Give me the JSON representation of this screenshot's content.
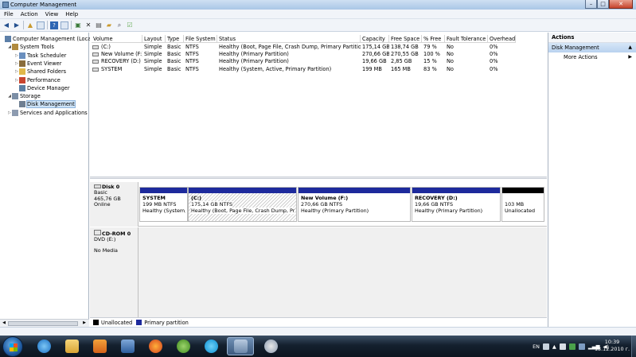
{
  "window": {
    "title": "Computer Management",
    "min": "–",
    "max": "□",
    "close": "✕"
  },
  "menu": [
    "File",
    "Action",
    "View",
    "Help"
  ],
  "tree": [
    {
      "label": "Computer Management (Local",
      "indent": 0,
      "exp": "",
      "icon": "computer-icon",
      "color": "#5c7fa8"
    },
    {
      "label": "System Tools",
      "indent": 1,
      "exp": "◢",
      "icon": "tools-icon",
      "color": "#b08a3e"
    },
    {
      "label": "Task Scheduler",
      "indent": 2,
      "exp": "▷",
      "icon": "clock-icon",
      "color": "#6a8fbe"
    },
    {
      "label": "Event Viewer",
      "indent": 2,
      "exp": "▷",
      "icon": "event-icon",
      "color": "#8a6d3b"
    },
    {
      "label": "Shared Folders",
      "indent": 2,
      "exp": "▷",
      "icon": "folder-icon",
      "color": "#e0b84a"
    },
    {
      "label": "Performance",
      "indent": 2,
      "exp": "▷",
      "icon": "performance-icon",
      "color": "#c8452f"
    },
    {
      "label": "Device Manager",
      "indent": 2,
      "exp": "",
      "icon": "device-icon",
      "color": "#5b7fa3"
    },
    {
      "label": "Storage",
      "indent": 1,
      "exp": "◢",
      "icon": "storage-icon",
      "color": "#7b8ea6"
    },
    {
      "label": "Disk Management",
      "indent": 2,
      "exp": "",
      "icon": "disk-icon",
      "color": "#6f7f92",
      "selected": true
    },
    {
      "label": "Services and Applications",
      "indent": 1,
      "exp": "▷",
      "icon": "services-icon",
      "color": "#8d9bb0"
    }
  ],
  "volumes": {
    "headers": [
      "Volume",
      "Layout",
      "Type",
      "File System",
      "Status",
      "Capacity",
      "Free Space",
      "% Free",
      "Fault Tolerance",
      "Overhead"
    ],
    "rows": [
      [
        "(C:)",
        "Simple",
        "Basic",
        "NTFS",
        "Healthy (Boot, Page File, Crash Dump, Primary Partition)",
        "175,14 GB",
        "138,74 GB",
        "79 %",
        "No",
        "0%"
      ],
      [
        "New Volume (F:)",
        "Simple",
        "Basic",
        "NTFS",
        "Healthy (Primary Partition)",
        "270,66 GB",
        "270,55 GB",
        "100 %",
        "No",
        "0%"
      ],
      [
        "RECOVERY (D:)",
        "Simple",
        "Basic",
        "NTFS",
        "Healthy (Primary Partition)",
        "19,66 GB",
        "2,85 GB",
        "15 %",
        "No",
        "0%"
      ],
      [
        "SYSTEM",
        "Simple",
        "Basic",
        "NTFS",
        "Healthy (System, Active, Primary Partition)",
        "199 MB",
        "165 MB",
        "83 %",
        "No",
        "0%"
      ]
    ]
  },
  "disk0": {
    "name": "Disk 0",
    "type": "Basic",
    "size": "465,76 GB",
    "state": "Online",
    "partitions": [
      {
        "name": "SYSTEM",
        "size": "199 MB NTFS",
        "status": "Healthy (System,",
        "bar": "#1d2a9c"
      },
      {
        "name": "(C:)",
        "size": "175,14 GB NTFS",
        "status": "Healthy (Boot, Page File, Crash Dump, Pri",
        "bar": "#1d2a9c",
        "hatched": true
      },
      {
        "name": "New Volume  (F:)",
        "size": "270,66 GB NTFS",
        "status": "Healthy (Primary Partition)",
        "bar": "#1d2a9c"
      },
      {
        "name": "RECOVERY  (D:)",
        "size": "19,66 GB NTFS",
        "status": "Healthy (Primary Partition)",
        "bar": "#1d2a9c"
      },
      {
        "name": "",
        "size": "103 MB",
        "status": "Unallocated",
        "bar": "#000000"
      }
    ]
  },
  "cdrom": {
    "name": "CD-ROM 0",
    "type": "DVD (E:)",
    "state": "No Media"
  },
  "legend": [
    {
      "label": "Unallocated",
      "color": "#000000"
    },
    {
      "label": "Primary partition",
      "color": "#1d2a9c"
    }
  ],
  "actions": {
    "header": "Actions",
    "section": "Disk Management",
    "items": [
      "More Actions"
    ]
  },
  "tray": {
    "lang": "EN",
    "time": "10:39",
    "date": "13.12.2010 г."
  }
}
